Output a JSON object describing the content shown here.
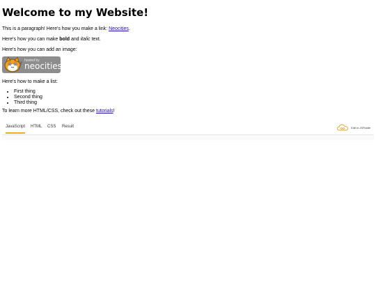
{
  "heading": "Welcome to my Website!",
  "para1": {
    "before": "This is a paragraph! Here's how you make a link: ",
    "link": "Neocities",
    "after": "."
  },
  "para2": {
    "before": "Here's how you can make ",
    "bold": "bold",
    "middle": " and ",
    "italic": "italic",
    "after": " text."
  },
  "para3": "Here's how you can add an image:",
  "badge": {
    "small": "hosted by",
    "big": "neocities"
  },
  "para4": "Here's how to make a list:",
  "list": [
    "First thing",
    "Second thing",
    "Third thing"
  ],
  "para5": {
    "before": "To learn more HTML/CSS, check out these ",
    "link": "tutorials",
    "after": "!"
  },
  "jsfiddle": {
    "tabs": [
      "JavaScript",
      "HTML",
      "CSS",
      "Result"
    ],
    "active_tab": "JavaScript",
    "edit_label": "Edit in JSFiddle",
    "accent": "#f2ac18"
  }
}
